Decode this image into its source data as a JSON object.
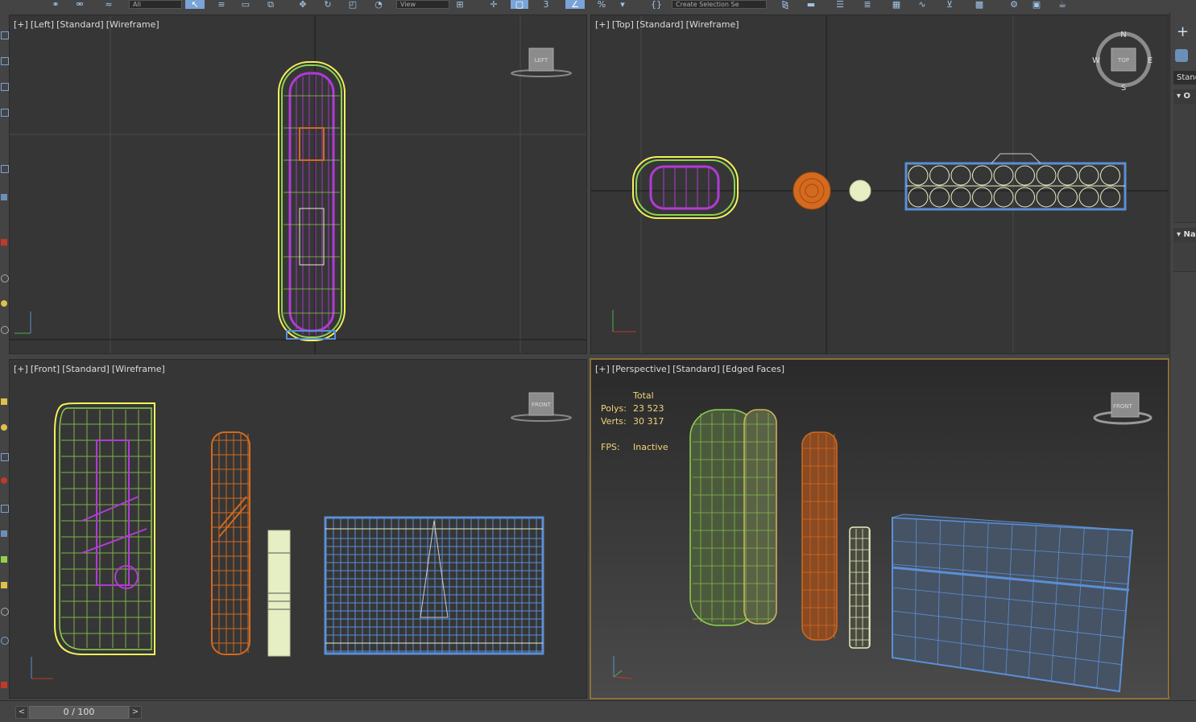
{
  "toolbar": {
    "selection_filter": "All",
    "ref_coord": "View",
    "named_selection": "Create Selection Se"
  },
  "viewports": {
    "left": {
      "plus": "[+]",
      "name": "[Left]",
      "shading_std": "[Standard]",
      "mode": "[Wireframe]",
      "cube_label": "LEFT"
    },
    "top": {
      "plus": "[+]",
      "name": "[Top]",
      "shading_std": "[Standard]",
      "mode": "[Wireframe]",
      "cube_label": "TOP",
      "compass": {
        "n": "N",
        "s": "S",
        "e": "E",
        "w": "W"
      }
    },
    "front": {
      "plus": "[+]",
      "name": "[Front]",
      "shading_std": "[Standard]",
      "mode": "[Wireframe]",
      "cube_label": "FRONT"
    },
    "perspective": {
      "plus": "[+]",
      "name": "[Perspective]",
      "shading_std": "[Standard]",
      "mode": "[Edged Faces]",
      "cube_label": "FRONT"
    }
  },
  "stats": {
    "header": "Total",
    "polys_label": "Polys:",
    "polys_value": "23 523",
    "verts_label": "Verts:",
    "verts_value": "30 317",
    "fps_label": "FPS:",
    "fps_value": "Inactive"
  },
  "command_panel": {
    "dropdown": "Stand",
    "rollout1": "O",
    "rollout2": "Na"
  },
  "timeline": {
    "prev": "<",
    "frame": "0 / 100",
    "next": ">"
  },
  "colors": {
    "green_object": "#8fd14f",
    "magenta_object": "#b13bd6",
    "orange_object": "#d36a1f",
    "cream_object": "#e6eec3",
    "blue_object": "#5b8fd6",
    "selection_yellow": "#f4f25a",
    "active_border": "#8a6f3a"
  }
}
